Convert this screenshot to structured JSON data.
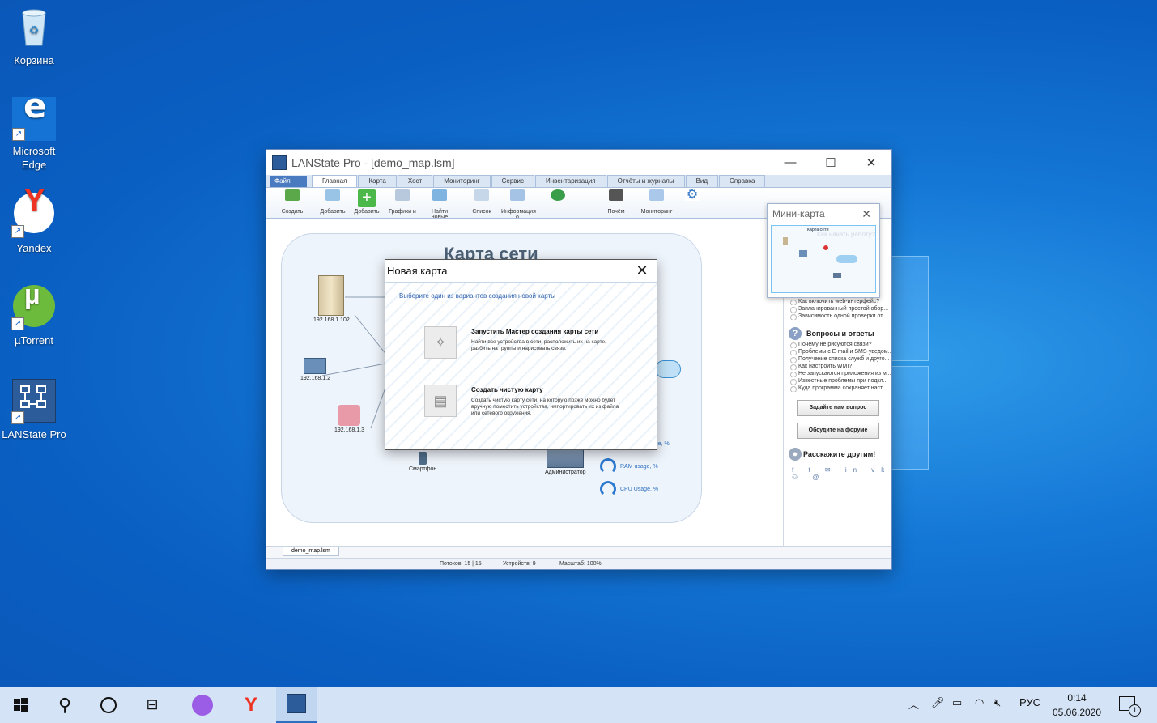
{
  "desktop": {
    "icons": [
      {
        "label": "Корзина"
      },
      {
        "label": "Microsoft Edge"
      },
      {
        "label": "Yandex"
      },
      {
        "label": "µTorrent"
      },
      {
        "label": "LANState Pro"
      }
    ]
  },
  "window": {
    "title": "LANState Pro - [demo_map.lsm]",
    "menu": {
      "file": "Файл",
      "tabs": [
        "Главная",
        "Карта",
        "Хост",
        "Мониторинг",
        "Сервис",
        "Инвентаризация",
        "Отчёты и журналы",
        "Вид",
        "Справка"
      ],
      "active_tab": "Главная"
    },
    "ribbon": [
      "Создать",
      "Добавить",
      "Добавить",
      "Графики и",
      "Найти новые",
      "Список",
      "Информация о",
      "Почём",
      "Мониторинг"
    ],
    "map": {
      "title": "Карта сети",
      "nodes": [
        "192.168.1.102",
        "192.168.1.2",
        "192.168.1.3",
        "Смартфон",
        "Администратор"
      ],
      "gauges": [
        "Hard disk usage, %",
        "RAM usage, %",
        "CPU Usage, %"
      ]
    },
    "side": {
      "top_items": [
        "Как включить web-интерфейс?",
        "Запланированный простой обор...",
        "Зависимость одной проверки от ..."
      ],
      "qa_title": "Вопросы и ответы",
      "qa_items": [
        "Почему не рисуются связи?",
        "Проблемы с E-mail и SMS-уведом...",
        "Получение списка служб и друго...",
        "Как настроить WMI?",
        "Не запускаются приложения из м...",
        "Известные проблемы при подкл...",
        "Куда программа сохраняет наст..."
      ],
      "ask_button": "Задайте нам вопрос",
      "forum_button": "Обсудите на форуме",
      "share_title": "Расскажите другим!",
      "socials": "f t ✉ in vk ⚇ @"
    },
    "doc_tab": "demo_map.lsm",
    "status": {
      "threads": "Потоков: 15 | 15",
      "devices": "Устройств: 9",
      "zoom": "Масштаб: 100%"
    }
  },
  "minimap": {
    "title": "Мини-карта",
    "preview_title": "Карта сети",
    "faded_text": "Как начать работу?"
  },
  "dialog": {
    "title": "Новая карта",
    "hint": "Выберите один из вариантов создания новой карты",
    "options": [
      {
        "title": "Запустить Мастер создания карты сети",
        "desc": "Найти все устройства в сети, расположить их на карте, разбить на группы и нарисовать связи."
      },
      {
        "title": "Создать чистую карту",
        "desc": "Создать чистую карту сети, на которую позже можно будет вручную поместить устройства, импортировать их из файла или сетевого окружения."
      }
    ]
  },
  "taskbar": {
    "lang": "РУС",
    "time": "0:14",
    "date": "05.06.2020",
    "notifications": "1"
  }
}
